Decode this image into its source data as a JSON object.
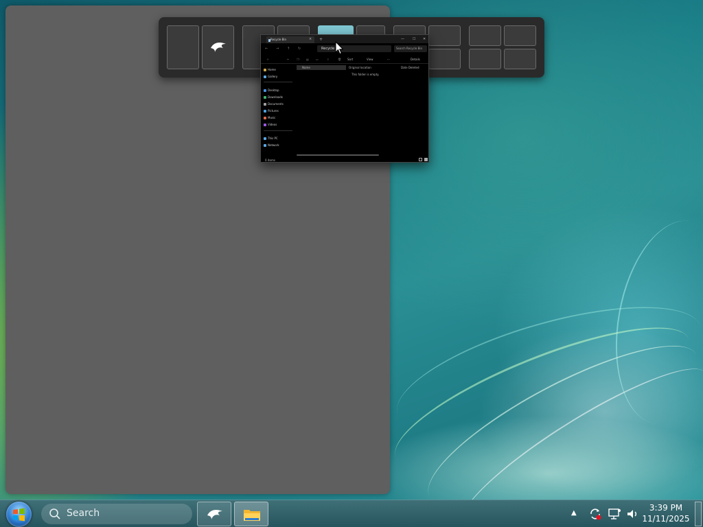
{
  "explorer": {
    "tab_label": "Recycle Bin",
    "tab_close": "×",
    "new_tab": "+",
    "win_minimize": "—",
    "win_maximize": "☐",
    "win_close": "✕",
    "nav": {
      "back": "←",
      "forward": "→",
      "up": "↑",
      "refresh": "↻"
    },
    "address": "Recycle Bin",
    "search_placeholder": "Search Recycle Bin",
    "cmd": {
      "sort": "Sort",
      "view": "View",
      "more": "···",
      "details": "Details"
    },
    "nav_pane": [
      {
        "label": "Home",
        "color": "#c9a54a"
      },
      {
        "label": "Gallery",
        "color": "#5aa7e0"
      },
      {
        "label": "Desktop",
        "color": "#4a8fe0"
      },
      {
        "label": "Downloads",
        "color": "#3fb36b"
      },
      {
        "label": "Documents",
        "color": "#a0a0a0"
      },
      {
        "label": "Pictures",
        "color": "#4aa3e0"
      },
      {
        "label": "Music",
        "color": "#e06a4a"
      },
      {
        "label": "Videos",
        "color": "#9a5ae0"
      },
      {
        "label": "This PC",
        "color": "#5aa7e0"
      },
      {
        "label": "Network",
        "color": "#5aa7e0"
      }
    ],
    "columns": {
      "name": "Name",
      "original_location": "Original location",
      "date_deleted": "Date Deleted"
    },
    "empty_message": "This folder is empty.",
    "status": "0 items"
  },
  "taskbar": {
    "search_label": "Search",
    "apps": [
      {
        "name": "pinned-app",
        "active": false
      },
      {
        "name": "file-explorer",
        "active": true
      }
    ],
    "tray_arrow": "▲",
    "time": "3:39 PM",
    "date": "11/11/2025"
  }
}
